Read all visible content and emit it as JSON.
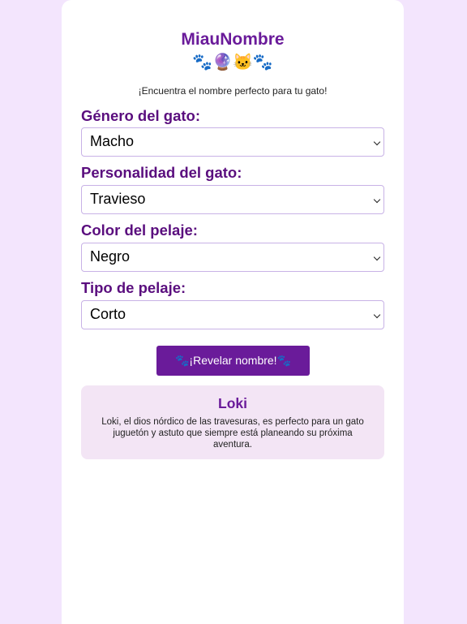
{
  "header": {
    "title": "MiauNombre",
    "emoji": "🐾🔮🐱🐾",
    "subtitle": "¡Encuentra el nombre perfecto para tu gato!"
  },
  "form": {
    "gender": {
      "label": "Género del gato:",
      "value": "Macho"
    },
    "personality": {
      "label": "Personalidad del gato:",
      "value": "Travieso"
    },
    "color": {
      "label": "Color del pelaje:",
      "value": "Negro"
    },
    "fur": {
      "label": "Tipo de pelaje:",
      "value": "Corto"
    }
  },
  "button": {
    "label": "🐾¡Revelar nombre!🐾"
  },
  "result": {
    "name": "Loki",
    "description": "Loki, el dios nórdico de las travesuras, es perfecto para un gato juguetón y astuto que siempre está planeando su próxima aventura."
  },
  "colors": {
    "page_background": "#f3e5fd",
    "accent": "#6a1b9a",
    "label": "#5a0e7e",
    "result_background": "#f3e5f5"
  },
  "icons": [
    "paw-icon",
    "crystal-ball-icon",
    "cat-face-icon",
    "chevron-down-icon"
  ]
}
